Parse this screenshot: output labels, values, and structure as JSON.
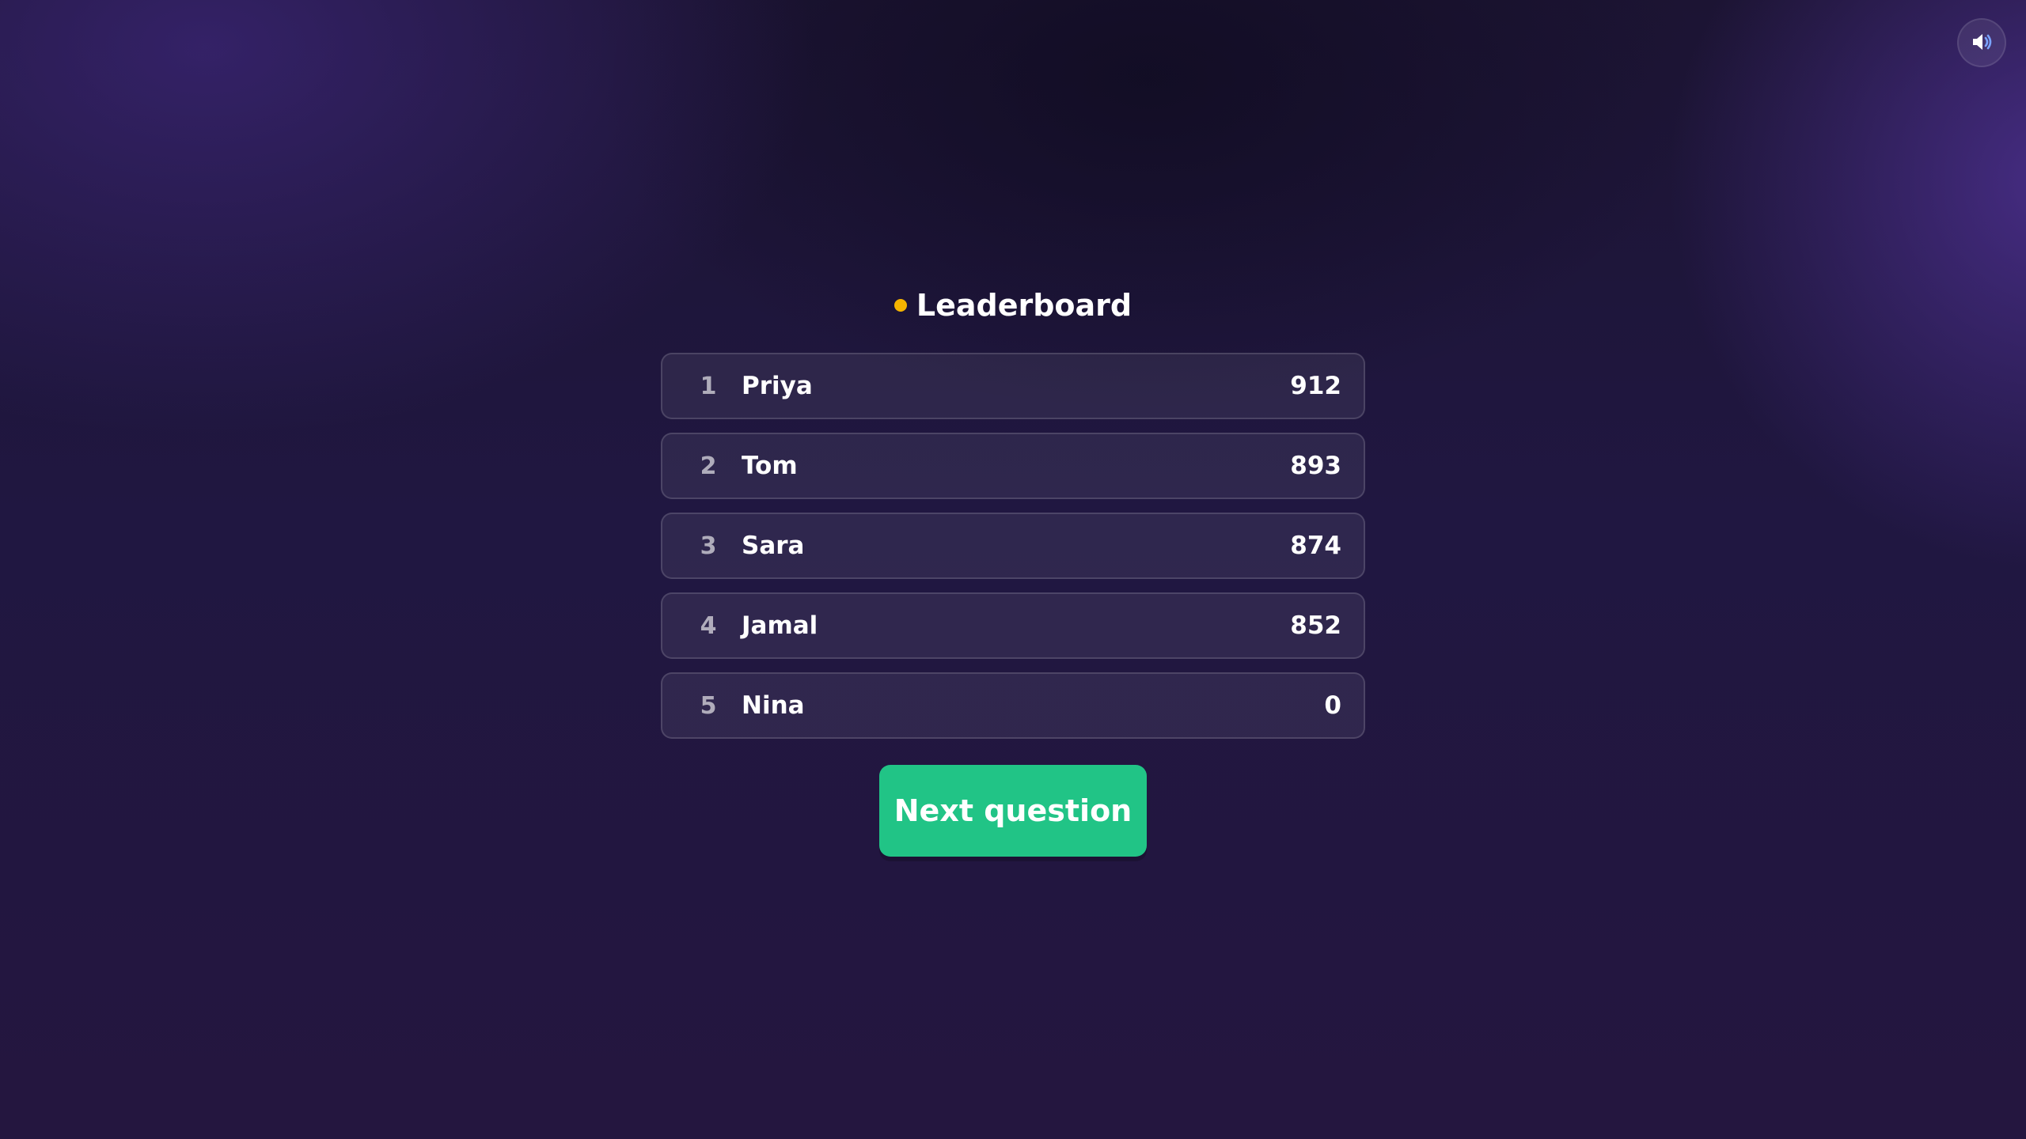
{
  "header": {
    "sound_icon": "speaker-volume-icon"
  },
  "leaderboard": {
    "title": "Leaderboard",
    "dot_color": "#f5b400",
    "rows": [
      {
        "rank": "1",
        "name": "Priya",
        "score": "912"
      },
      {
        "rank": "2",
        "name": "Tom",
        "score": "893"
      },
      {
        "rank": "3",
        "name": "Sara",
        "score": "874"
      },
      {
        "rank": "4",
        "name": "Jamal",
        "score": "852"
      },
      {
        "rank": "5",
        "name": "Nina",
        "score": "0"
      }
    ]
  },
  "actions": {
    "next_label": "Next question",
    "next_color": "#21c486"
  }
}
